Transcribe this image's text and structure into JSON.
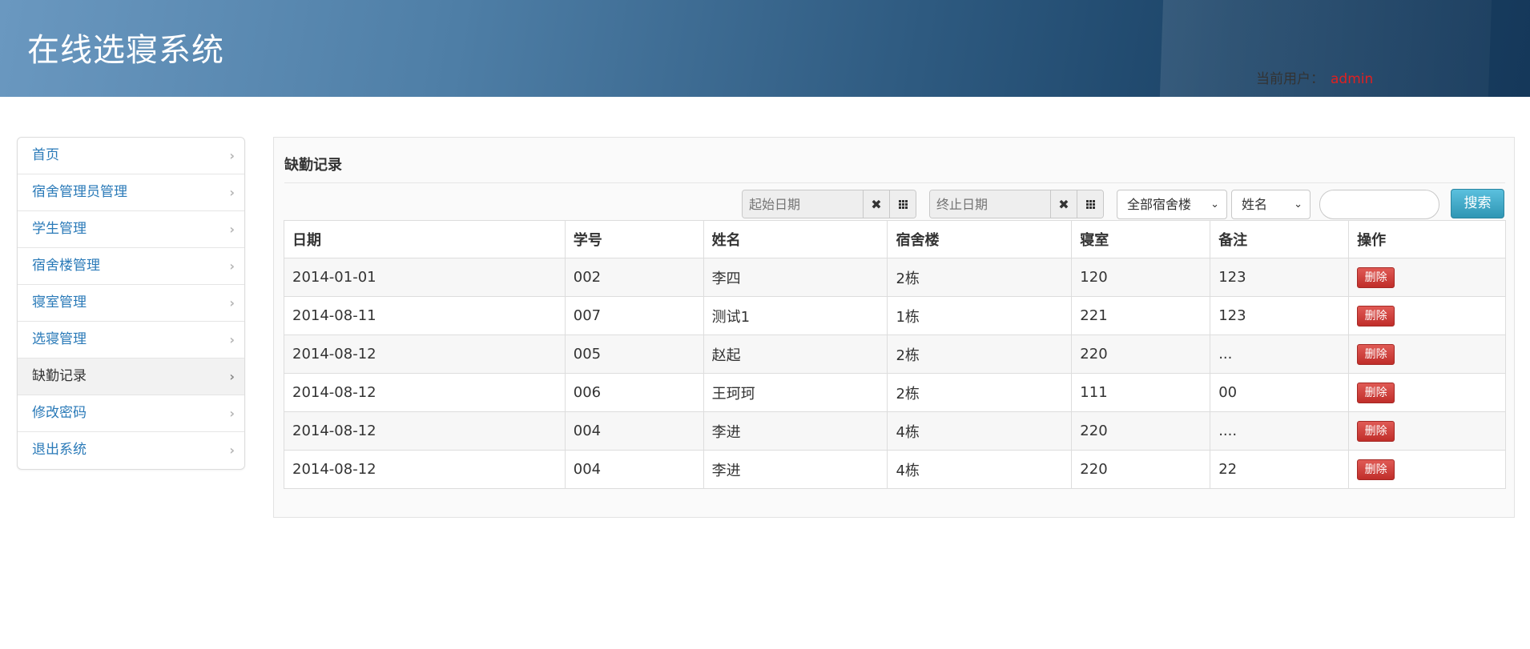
{
  "header": {
    "title": "在线选寝系统",
    "user_label": "当前用户：",
    "username": "admin"
  },
  "sidebar": {
    "items": [
      {
        "label": "首页",
        "active": false
      },
      {
        "label": "宿舍管理员管理",
        "active": false
      },
      {
        "label": "学生管理",
        "active": false
      },
      {
        "label": "宿舍楼管理",
        "active": false
      },
      {
        "label": "寝室管理",
        "active": false
      },
      {
        "label": "选寝管理",
        "active": false
      },
      {
        "label": "缺勤记录",
        "active": true
      },
      {
        "label": "修改密码",
        "active": false
      },
      {
        "label": "退出系统",
        "active": false
      }
    ],
    "chevron": "›"
  },
  "main": {
    "title": "缺勤记录",
    "toolbar": {
      "start_date_placeholder": "起始日期",
      "end_date_placeholder": "终止日期",
      "clear_glyph": "✖",
      "building_select": "全部宿舍楼",
      "field_select": "姓名",
      "search_value": "",
      "search_button": "搜索",
      "caret": "⌄"
    },
    "table": {
      "headers": [
        "日期",
        "学号",
        "姓名",
        "宿舍楼",
        "寝室",
        "备注",
        "操作"
      ],
      "rows": [
        [
          "2014-01-01",
          "002",
          "李四",
          "2栋",
          "120",
          "123"
        ],
        [
          "2014-08-11",
          "007",
          "测试1",
          "1栋",
          "221",
          "123"
        ],
        [
          "2014-08-12",
          "005",
          "赵起",
          "2栋",
          "220",
          "..."
        ],
        [
          "2014-08-12",
          "006",
          "王珂珂",
          "2栋",
          "111",
          "00"
        ],
        [
          "2014-08-12",
          "004",
          "李进",
          "4栋",
          "220",
          "...."
        ],
        [
          "2014-08-12",
          "004",
          "李进",
          "4栋",
          "220",
          "22"
        ]
      ],
      "delete_label": "删除"
    }
  },
  "colors": {
    "link": "#2a7ab8",
    "danger": "#c9302c",
    "info": "#5bc0de",
    "username": "#e02020"
  }
}
